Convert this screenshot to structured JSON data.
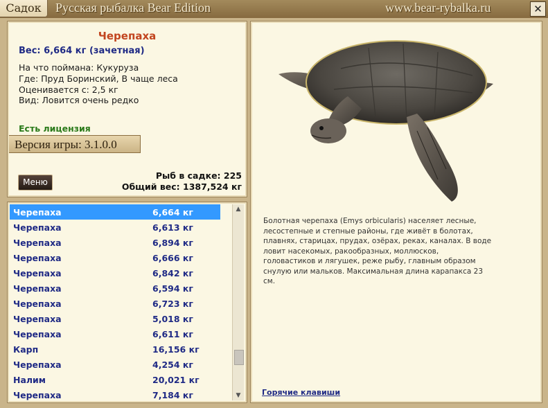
{
  "titlebar": {
    "tab_label": "Садок",
    "title": "Русская рыбалка Bear Edition",
    "site": "www.bear-rybalka.ru",
    "close_label": "✕"
  },
  "fish_info": {
    "name": "Черепаха",
    "weight_line": "Вес: 6,664 кг (зачетная)",
    "caught_on": "На что поймана: Кукуруза",
    "where": "Где: Пруд Боринский, В чаще леса",
    "valued_from": "Оценивается с: 2,5 кг",
    "kind": "Вид: Ловится очень редко",
    "license": "Есть лицензия",
    "version": "Версия игры: 3.1.0.0",
    "menu_label": "Меню",
    "fish_count": "Рыб в садке: 225",
    "total_weight": "Общий вес: 1387,524 кг"
  },
  "fish_list": {
    "selected_index": 0,
    "rows": [
      {
        "name": "Черепаха",
        "weight": "6,664 кг"
      },
      {
        "name": "Черепаха",
        "weight": "6,613 кг"
      },
      {
        "name": "Черепаха",
        "weight": "6,894 кг"
      },
      {
        "name": "Черепаха",
        "weight": "6,666 кг"
      },
      {
        "name": "Черепаха",
        "weight": "6,842 кг"
      },
      {
        "name": "Черепаха",
        "weight": "6,594 кг"
      },
      {
        "name": "Черепаха",
        "weight": "6,723 кг"
      },
      {
        "name": "Черепаха",
        "weight": "5,018 кг"
      },
      {
        "name": "Черепаха",
        "weight": "6,611 кг"
      },
      {
        "name": "Карп",
        "weight": "16,156 кг"
      },
      {
        "name": "Черепаха",
        "weight": "4,254 кг"
      },
      {
        "name": "Налим",
        "weight": "20,021 кг"
      },
      {
        "name": "Черепаха",
        "weight": "7,184 кг"
      }
    ]
  },
  "description": "Болотная черепаха (Emys orbicularis) населяет лесные, лесостепные и степные районы, где живёт в болотах, плавнях, старицах, прудах, озёрах, реках, каналах. В воде ловит насекомых, ракообразных, моллюсков, головастиков и лягушек, реже рыбу, главным образом снулую или мальков. Максимальная длина карапакса 23 см.",
  "hotkeys_label": "Горячие клавиши",
  "colors": {
    "accent_title": "#c2451f",
    "text_blue": "#1f2a85",
    "license_green": "#2a7a1a",
    "selection": "#3399ff"
  }
}
